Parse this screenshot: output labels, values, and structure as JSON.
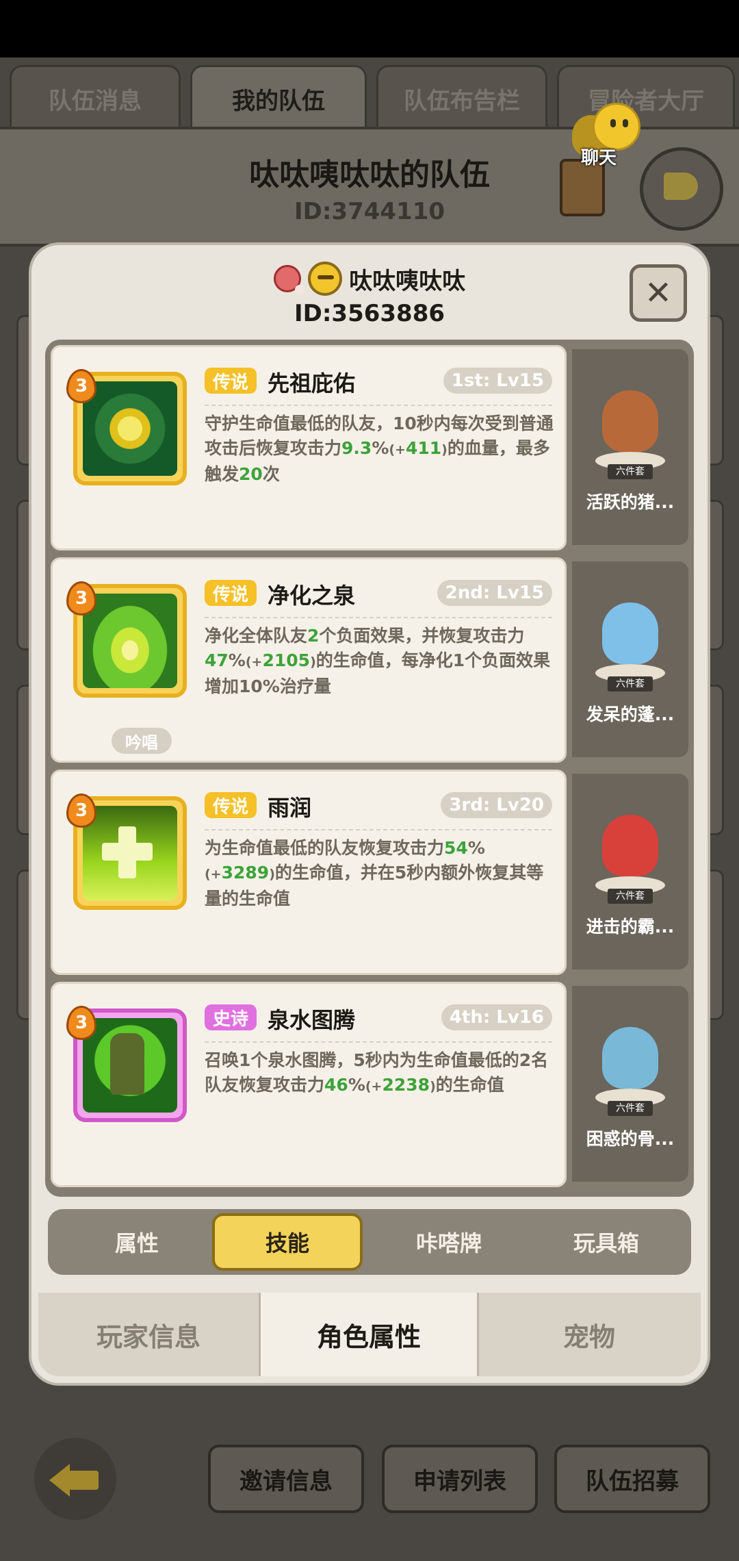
{
  "top_tabs": [
    {
      "label": "队伍消息"
    },
    {
      "label": "我的队伍"
    },
    {
      "label": "队伍布告栏"
    },
    {
      "label": "冒险者大厅"
    }
  ],
  "team": {
    "name": "呔呔咦呔呔的队伍",
    "id": "ID:3744110"
  },
  "chat": {
    "label": "聊天"
  },
  "player": {
    "name": "呔呔咦呔呔",
    "id": "ID:3563886"
  },
  "close_symbol": "✕",
  "skills": [
    {
      "rarity": "传说",
      "name": "先祖庇佑",
      "slot": "1st: Lv15",
      "level": "3",
      "desc": {
        "p1": "守护生命值最低的队友，10秒内每次受到普通攻击后恢复攻击力",
        "v1": "9.3",
        "pct": "%",
        "bo": "(+",
        "v2": "411",
        "bc": ")",
        "p2": "的血量，最多触发",
        "v3": "20",
        "p3": "次"
      }
    },
    {
      "rarity": "传说",
      "name": "净化之泉",
      "slot": "2nd: Lv15",
      "level": "3",
      "tag": "吟唱",
      "desc": {
        "p1": "净化全体队友",
        "v1": "2",
        "p2": "个负面效果，并恢复攻击力",
        "v2": "47",
        "pct": "%",
        "bo": "(+",
        "v3": "2105",
        "bc": ")",
        "p3": "的生命值，每净化1个负面效果增加10%治疗量"
      }
    },
    {
      "rarity": "传说",
      "name": "雨润",
      "slot": "3rd: Lv20",
      "level": "3",
      "desc": {
        "p1": "为生命值最低的队友恢复攻击力",
        "v1": "54",
        "pct": "%",
        "bo": "(+",
        "v2": "3289",
        "bc": ")",
        "p2": "的生命值，并在5秒内额外恢复其等量的生命值"
      }
    },
    {
      "rarity": "史诗",
      "name": "泉水图腾",
      "slot": "4th: Lv16",
      "level": "3",
      "desc": {
        "p1": "召唤1个泉水图腾，5秒内为生命值最低的2名队友恢复攻击力",
        "v1": "46",
        "pct": "%",
        "bo": "(+",
        "v2": "2238",
        "bc": ")",
        "p2": "的生命值"
      }
    }
  ],
  "outfits": [
    {
      "name": "活跃的猪...",
      "set": "六件套",
      "color": "#b8693a"
    },
    {
      "name": "发呆的蓬...",
      "set": "六件套",
      "color": "#7fc0e8"
    },
    {
      "name": "进击的霸...",
      "set": "六件套",
      "color": "#d8403a"
    },
    {
      "name": "困惑的骨...",
      "set": "六件套",
      "color": "#7ab8d8"
    }
  ],
  "sub_tabs": [
    {
      "label": "属性"
    },
    {
      "label": "技能"
    },
    {
      "label": "咔嗒牌"
    },
    {
      "label": "玩具箱"
    }
  ],
  "bottom_tabs": [
    {
      "label": "玩家信息"
    },
    {
      "label": "角色属性"
    },
    {
      "label": "宠物"
    }
  ],
  "bottom_buttons": [
    {
      "label": "邀请信息"
    },
    {
      "label": "申请列表"
    },
    {
      "label": "队伍招募"
    }
  ],
  "colors": {
    "legend": "#f5c028",
    "epic": "#e070e0",
    "highlight": "#3da23a",
    "active_tab": "#f4d35a"
  }
}
